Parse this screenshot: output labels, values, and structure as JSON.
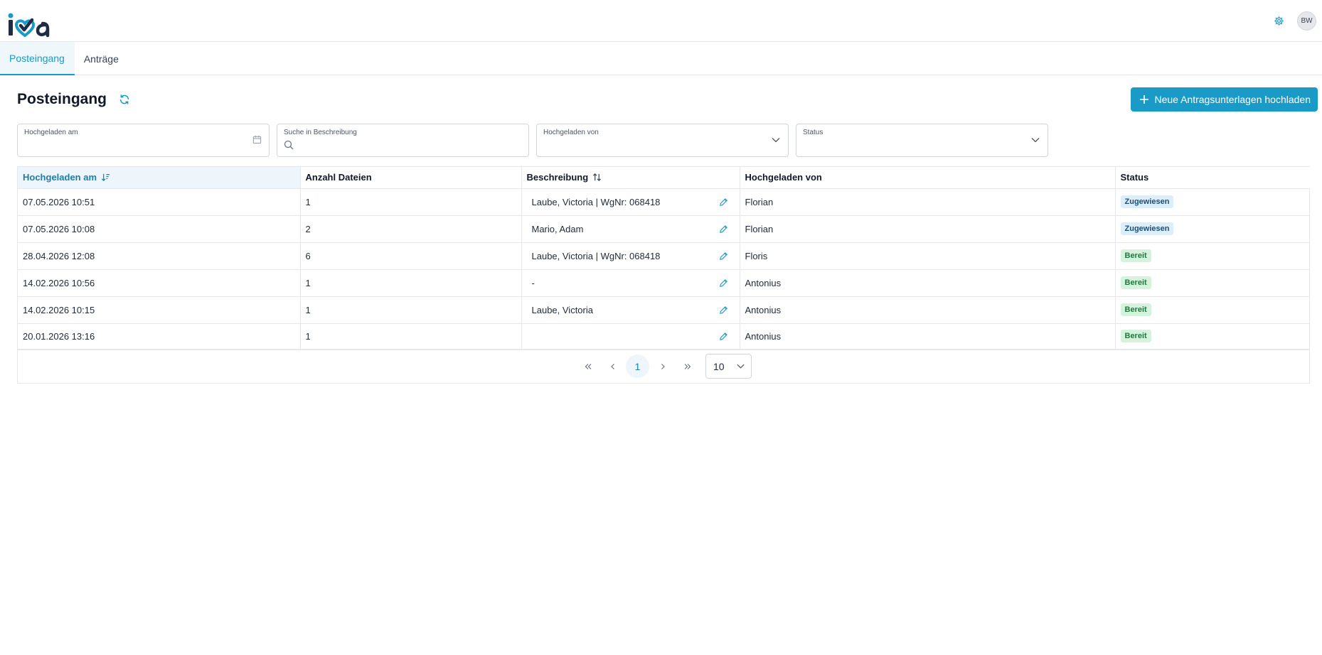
{
  "header": {
    "logo_text": "iva",
    "avatar_initials": "BW",
    "settings_icon": "gear-icon",
    "accent_color": "#1a9ac7"
  },
  "tabs": [
    {
      "label": "Posteingang",
      "active": true
    },
    {
      "label": "Anträge",
      "active": false
    }
  ],
  "page": {
    "title": "Posteingang",
    "refresh_icon": "refresh-icon",
    "upload_button_label": "Neue Antragsunterlagen hochladen"
  },
  "filters": {
    "uploaded_at_label": "Hochgeladen am",
    "search_label": "Suche in Beschreibung",
    "uploaded_by_label": "Hochgeladen von",
    "status_label": "Status"
  },
  "table": {
    "columns": [
      {
        "label": "Hochgeladen am",
        "sort": "desc"
      },
      {
        "label": "Anzahl Dateien",
        "sort": "none"
      },
      {
        "label": "Beschreibung",
        "sort": "both"
      },
      {
        "label": "Hochgeladen von",
        "sort": "none"
      },
      {
        "label": "Status",
        "sort": "none"
      }
    ],
    "rows": [
      {
        "date": "07.05.2026 10:51",
        "files": "1",
        "description": "Laube, Victoria | WgNr: 068418",
        "uploader": "Florian",
        "status": "Zugewiesen",
        "status_kind": "assigned"
      },
      {
        "date": "07.05.2026 10:08",
        "files": "2",
        "description": "Mario, Adam",
        "uploader": "Florian",
        "status": "Zugewiesen",
        "status_kind": "assigned"
      },
      {
        "date": "28.04.2026 12:08",
        "files": "6",
        "description": "Laube, Victoria | WgNr: 068418",
        "uploader": "Floris",
        "status": "Bereit",
        "status_kind": "ready"
      },
      {
        "date": "14.02.2026 10:56",
        "files": "1",
        "description": "-",
        "uploader": "Antonius",
        "status": "Bereit",
        "status_kind": "ready"
      },
      {
        "date": "14.02.2026 10:15",
        "files": "1",
        "description": "Laube, Victoria",
        "uploader": "Antonius",
        "status": "Bereit",
        "status_kind": "ready"
      },
      {
        "date": "20.01.2026 13:16",
        "files": "1",
        "description": "",
        "uploader": "Antonius",
        "status": "Bereit",
        "status_kind": "ready"
      }
    ]
  },
  "pagination": {
    "current_page": "1",
    "rows_per_page": "10"
  }
}
